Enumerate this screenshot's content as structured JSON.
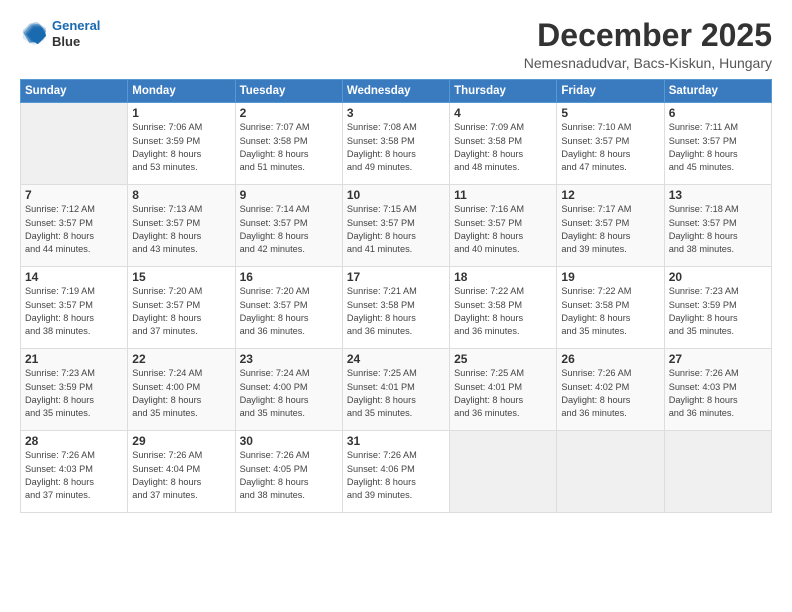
{
  "logo": {
    "line1": "General",
    "line2": "Blue"
  },
  "title": "December 2025",
  "location": "Nemesnadudvar, Bacs-Kiskun, Hungary",
  "days_header": [
    "Sunday",
    "Monday",
    "Tuesday",
    "Wednesday",
    "Thursday",
    "Friday",
    "Saturday"
  ],
  "weeks": [
    [
      {
        "num": "",
        "info": ""
      },
      {
        "num": "1",
        "info": "Sunrise: 7:06 AM\nSunset: 3:59 PM\nDaylight: 8 hours\nand 53 minutes."
      },
      {
        "num": "2",
        "info": "Sunrise: 7:07 AM\nSunset: 3:58 PM\nDaylight: 8 hours\nand 51 minutes."
      },
      {
        "num": "3",
        "info": "Sunrise: 7:08 AM\nSunset: 3:58 PM\nDaylight: 8 hours\nand 49 minutes."
      },
      {
        "num": "4",
        "info": "Sunrise: 7:09 AM\nSunset: 3:58 PM\nDaylight: 8 hours\nand 48 minutes."
      },
      {
        "num": "5",
        "info": "Sunrise: 7:10 AM\nSunset: 3:57 PM\nDaylight: 8 hours\nand 47 minutes."
      },
      {
        "num": "6",
        "info": "Sunrise: 7:11 AM\nSunset: 3:57 PM\nDaylight: 8 hours\nand 45 minutes."
      }
    ],
    [
      {
        "num": "7",
        "info": "Sunrise: 7:12 AM\nSunset: 3:57 PM\nDaylight: 8 hours\nand 44 minutes."
      },
      {
        "num": "8",
        "info": "Sunrise: 7:13 AM\nSunset: 3:57 PM\nDaylight: 8 hours\nand 43 minutes."
      },
      {
        "num": "9",
        "info": "Sunrise: 7:14 AM\nSunset: 3:57 PM\nDaylight: 8 hours\nand 42 minutes."
      },
      {
        "num": "10",
        "info": "Sunrise: 7:15 AM\nSunset: 3:57 PM\nDaylight: 8 hours\nand 41 minutes."
      },
      {
        "num": "11",
        "info": "Sunrise: 7:16 AM\nSunset: 3:57 PM\nDaylight: 8 hours\nand 40 minutes."
      },
      {
        "num": "12",
        "info": "Sunrise: 7:17 AM\nSunset: 3:57 PM\nDaylight: 8 hours\nand 39 minutes."
      },
      {
        "num": "13",
        "info": "Sunrise: 7:18 AM\nSunset: 3:57 PM\nDaylight: 8 hours\nand 38 minutes."
      }
    ],
    [
      {
        "num": "14",
        "info": "Sunrise: 7:19 AM\nSunset: 3:57 PM\nDaylight: 8 hours\nand 38 minutes."
      },
      {
        "num": "15",
        "info": "Sunrise: 7:20 AM\nSunset: 3:57 PM\nDaylight: 8 hours\nand 37 minutes."
      },
      {
        "num": "16",
        "info": "Sunrise: 7:20 AM\nSunset: 3:57 PM\nDaylight: 8 hours\nand 36 minutes."
      },
      {
        "num": "17",
        "info": "Sunrise: 7:21 AM\nSunset: 3:58 PM\nDaylight: 8 hours\nand 36 minutes."
      },
      {
        "num": "18",
        "info": "Sunrise: 7:22 AM\nSunset: 3:58 PM\nDaylight: 8 hours\nand 36 minutes."
      },
      {
        "num": "19",
        "info": "Sunrise: 7:22 AM\nSunset: 3:58 PM\nDaylight: 8 hours\nand 35 minutes."
      },
      {
        "num": "20",
        "info": "Sunrise: 7:23 AM\nSunset: 3:59 PM\nDaylight: 8 hours\nand 35 minutes."
      }
    ],
    [
      {
        "num": "21",
        "info": "Sunrise: 7:23 AM\nSunset: 3:59 PM\nDaylight: 8 hours\nand 35 minutes."
      },
      {
        "num": "22",
        "info": "Sunrise: 7:24 AM\nSunset: 4:00 PM\nDaylight: 8 hours\nand 35 minutes."
      },
      {
        "num": "23",
        "info": "Sunrise: 7:24 AM\nSunset: 4:00 PM\nDaylight: 8 hours\nand 35 minutes."
      },
      {
        "num": "24",
        "info": "Sunrise: 7:25 AM\nSunset: 4:01 PM\nDaylight: 8 hours\nand 35 minutes."
      },
      {
        "num": "25",
        "info": "Sunrise: 7:25 AM\nSunset: 4:01 PM\nDaylight: 8 hours\nand 36 minutes."
      },
      {
        "num": "26",
        "info": "Sunrise: 7:26 AM\nSunset: 4:02 PM\nDaylight: 8 hours\nand 36 minutes."
      },
      {
        "num": "27",
        "info": "Sunrise: 7:26 AM\nSunset: 4:03 PM\nDaylight: 8 hours\nand 36 minutes."
      }
    ],
    [
      {
        "num": "28",
        "info": "Sunrise: 7:26 AM\nSunset: 4:03 PM\nDaylight: 8 hours\nand 37 minutes."
      },
      {
        "num": "29",
        "info": "Sunrise: 7:26 AM\nSunset: 4:04 PM\nDaylight: 8 hours\nand 37 minutes."
      },
      {
        "num": "30",
        "info": "Sunrise: 7:26 AM\nSunset: 4:05 PM\nDaylight: 8 hours\nand 38 minutes."
      },
      {
        "num": "31",
        "info": "Sunrise: 7:26 AM\nSunset: 4:06 PM\nDaylight: 8 hours\nand 39 minutes."
      },
      {
        "num": "",
        "info": ""
      },
      {
        "num": "",
        "info": ""
      },
      {
        "num": "",
        "info": ""
      }
    ]
  ]
}
